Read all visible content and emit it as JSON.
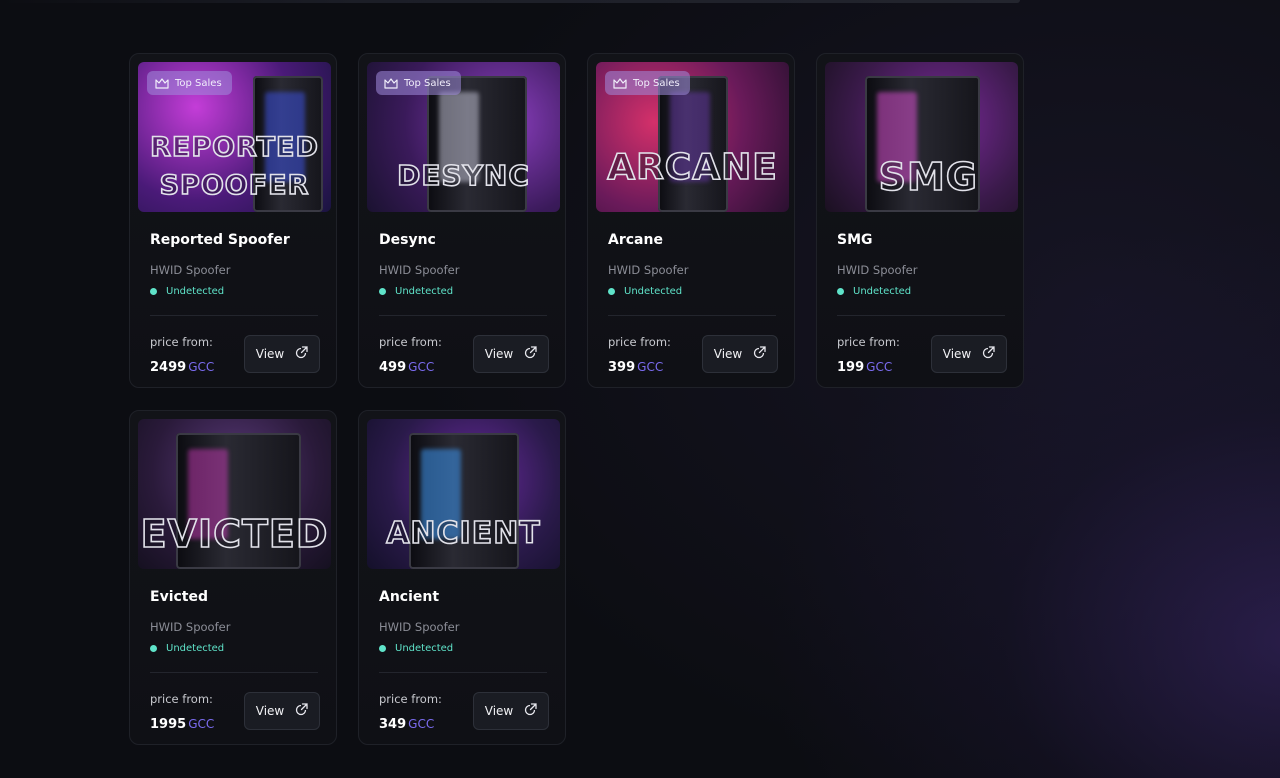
{
  "products": [
    {
      "name": "Reported Spoofer",
      "type": "HWID Spoofer",
      "status": "Undetected",
      "price_label": "price from:",
      "price": "2499",
      "currency": "GCC",
      "badge": "Top Sales",
      "thumb_line1": "REPORTED",
      "thumb_line2": "SPOOFER",
      "view_label": "View",
      "theme": "#7a2fd0"
    },
    {
      "name": "Desync",
      "type": "HWID Spoofer",
      "status": "Undetected",
      "price_label": "price from:",
      "price": "499",
      "currency": "GCC",
      "badge": "Top Sales",
      "thumb_line1": "DESYNC",
      "thumb_line2": "",
      "view_label": "View",
      "theme": "#5a2a88"
    },
    {
      "name": "Arcane",
      "type": "HWID Spoofer",
      "status": "Undetected",
      "price_label": "price from:",
      "price": "399",
      "currency": "GCC",
      "badge": "Top Sales",
      "thumb_line1": "ARCANE",
      "thumb_line2": "",
      "view_label": "View",
      "theme": "#a02a7a"
    },
    {
      "name": "SMG",
      "type": "HWID Spoofer",
      "status": "Undetected",
      "price_label": "price from:",
      "price": "199",
      "currency": "GCC",
      "badge": "",
      "thumb_line1": "SMG",
      "thumb_line2": "",
      "view_label": "View",
      "theme": "#6a2a8a"
    },
    {
      "name": "Evicted",
      "type": "HWID Spoofer",
      "status": "Undetected",
      "price_label": "price from:",
      "price": "1995",
      "currency": "GCC",
      "badge": "",
      "thumb_line1": "EVICTED",
      "thumb_line2": "",
      "view_label": "View",
      "theme": "#4a2a6a"
    },
    {
      "name": "Ancient",
      "type": "HWID Spoofer",
      "status": "Undetected",
      "price_label": "price from:",
      "price": "349",
      "currency": "GCC",
      "badge": "",
      "thumb_line1": "ANCIENT",
      "thumb_line2": "",
      "view_label": "View",
      "theme": "#5a2a8a"
    }
  ],
  "colors": {
    "status": "#5fe3c9",
    "currency": "#7b6cf0",
    "badge_bg": "#a08cdc"
  },
  "icons": {
    "badge": "crown-icon",
    "view": "external-link-icon"
  }
}
